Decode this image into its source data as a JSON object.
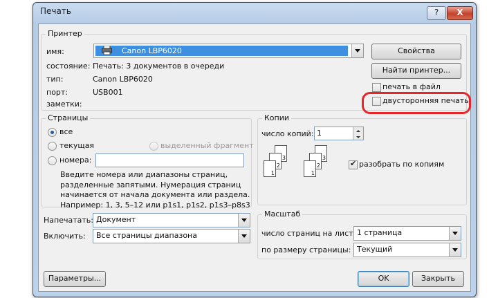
{
  "window": {
    "title": "Печать",
    "help_label": "?",
    "close_label": "X"
  },
  "printer": {
    "group_label": "Принтер",
    "name_label": "имя:",
    "name_value": "Canon LBP6020",
    "status_label": "состояние:",
    "status_value": "Печать: 3 документов в очереди",
    "type_label": "тип:",
    "type_value": "Canon LBP6020",
    "port_label": "порт:",
    "port_value": "USB001",
    "notes_label": "заметки:",
    "properties_button": "Свойства",
    "find_printer_button": "Найти принтер...",
    "print_to_file_label": "печать в файл",
    "print_to_file_checked": false,
    "duplex_label": "двусторонняя печать",
    "duplex_checked": false,
    "highlight_color": "#e8242a"
  },
  "pages": {
    "group_label": "Страницы",
    "all_label": "все",
    "current_label": "текущая",
    "selection_label": "выделенный фрагмент",
    "numbers_label": "номера:",
    "numbers_value": "",
    "selected": "all",
    "help_lines": [
      "Введите номера или диапазоны страниц,",
      "разделенные запятыми. Нумерация страниц",
      "начинается от начала документа или раздела.",
      "Например: 1, 3, 5–12 или p1s1, p1s2, p1s3–p8s3"
    ]
  },
  "copies": {
    "group_label": "Копии",
    "count_label": "число копий:",
    "count_value": "1",
    "collate_label": "разобрать по копиям",
    "collate_checked": true,
    "stack_numbers": [
      "3",
      "2",
      "1"
    ]
  },
  "print_what": {
    "label": "Напечатать:",
    "value": "Документ"
  },
  "include": {
    "label": "Включить:",
    "value": "Все страницы диапазона"
  },
  "zoom": {
    "group_label": "Масштаб",
    "pages_per_sheet_label": "число страниц на листе:",
    "pages_per_sheet_value": "1 страница",
    "scale_to_label": "по размеру страницы:",
    "scale_to_value": "Текущий"
  },
  "footer": {
    "options_button": "Параметры...",
    "ok_button": "OK",
    "close_button": "Закрыть"
  }
}
